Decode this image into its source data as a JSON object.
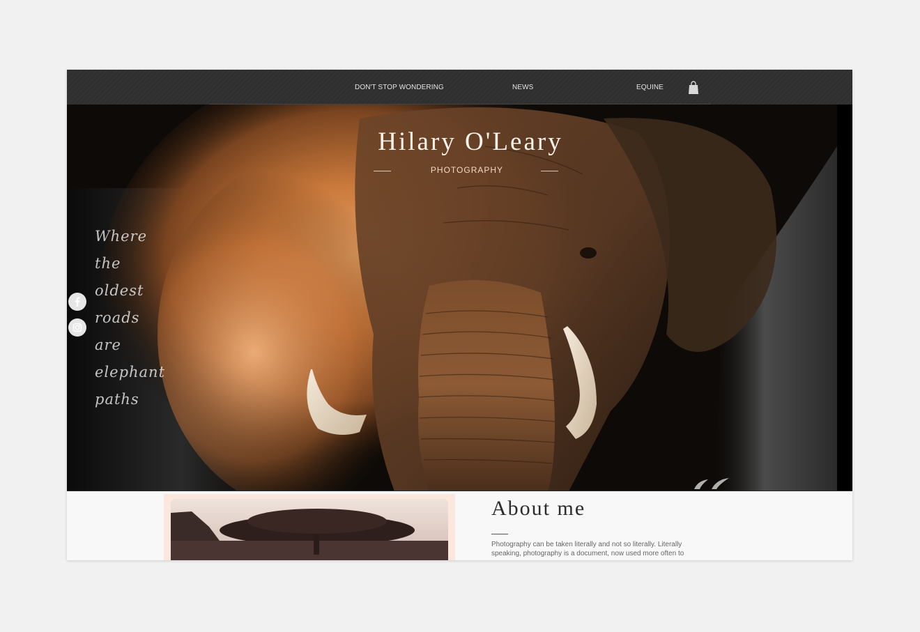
{
  "nav": {
    "items": [
      {
        "label": "DON'T STOP WONDERING"
      },
      {
        "label": "NEWS"
      },
      {
        "label": "EQUINE"
      }
    ],
    "cart_icon": "shopping-bag-icon"
  },
  "hero": {
    "title": "Hilary O'Leary",
    "subtitle": "PHOTOGRAPHY",
    "poem": [
      "Where",
      "the",
      "oldest",
      "roads",
      "are",
      "elephant",
      "paths"
    ],
    "social": [
      {
        "name": "facebook",
        "icon": "facebook-icon"
      },
      {
        "name": "instagram",
        "icon": "instagram-icon"
      }
    ]
  },
  "about": {
    "heading": "About me",
    "text": "Photography can be taken literally and not so literally. Literally speaking, photography is a document, now used more often to"
  },
  "colors": {
    "page_bg": "#f1f1f1",
    "nav_bg": "#2f2f2f",
    "hero_accent": "#c8772f",
    "title_text": "#fbf3ea"
  }
}
